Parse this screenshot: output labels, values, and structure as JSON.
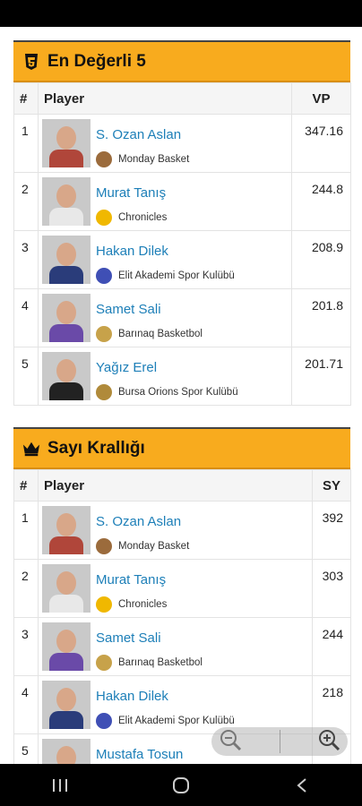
{
  "mvp": {
    "title": "En Değerli 5",
    "headers": {
      "rank": "#",
      "player": "Player",
      "value": "VP"
    },
    "rows": [
      {
        "rank": "1",
        "name": "S. Ozan Aslan",
        "team": "Monday Basket",
        "value": "347.16",
        "logo_color": "#9b6b3c",
        "jersey": "#b0463a"
      },
      {
        "rank": "2",
        "name": "Murat Tanış",
        "team": "Chronicles",
        "value": "244.8",
        "logo_color": "#f0b800",
        "jersey": "#e8e8e8"
      },
      {
        "rank": "3",
        "name": "Hakan Dilek",
        "team": "Elit Akademi Spor Kulübü",
        "value": "208.9",
        "logo_color": "#3f4fb5",
        "jersey": "#2a3c7a"
      },
      {
        "rank": "4",
        "name": "Samet Sali",
        "team": "Barınaq Basketbol",
        "value": "201.8",
        "logo_color": "#c7a24a",
        "jersey": "#6a4aa8"
      },
      {
        "rank": "5",
        "name": "Yağız Erel",
        "team": "Bursa Orions Spor Kulübü",
        "value": "201.71",
        "logo_color": "#b08a3a",
        "jersey": "#222222"
      }
    ]
  },
  "scoring": {
    "title": "Sayı Krallığı",
    "headers": {
      "rank": "#",
      "player": "Player",
      "value": "SY"
    },
    "rows": [
      {
        "rank": "1",
        "name": "S. Ozan Aslan",
        "team": "Monday Basket",
        "value": "392",
        "logo_color": "#9b6b3c",
        "jersey": "#b0463a"
      },
      {
        "rank": "2",
        "name": "Murat Tanış",
        "team": "Chronicles",
        "value": "303",
        "logo_color": "#f0b800",
        "jersey": "#e8e8e8"
      },
      {
        "rank": "3",
        "name": "Samet Sali",
        "team": "Barınaq Basketbol",
        "value": "244",
        "logo_color": "#c7a24a",
        "jersey": "#6a4aa8"
      },
      {
        "rank": "4",
        "name": "Hakan Dilek",
        "team": "Elit Akademi Spor Kulübü",
        "value": "218",
        "logo_color": "#3f4fb5",
        "jersey": "#2a3c7a"
      },
      {
        "rank": "5",
        "name": "Mustafa Tosun",
        "team": "",
        "value": "",
        "logo_color": "#999999",
        "jersey": "#cccccc"
      }
    ]
  },
  "icons": {
    "mvp_header": "html5-shield-icon",
    "scoring_header": "crown-icon",
    "zoom_out": "zoom-out-icon",
    "zoom_in": "zoom-in-icon",
    "nav_recents": "recents-icon",
    "nav_home": "home-icon",
    "nav_back": "back-icon"
  },
  "colors": {
    "header_bg": "#f8ab1e",
    "link": "#1d7fb8"
  }
}
